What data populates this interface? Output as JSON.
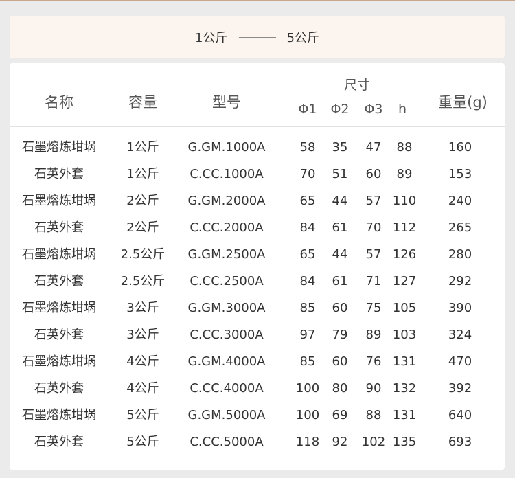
{
  "range": {
    "from": "1公斤",
    "to": "5公斤"
  },
  "headers": {
    "name": "名称",
    "capacity": "容量",
    "model": "型号",
    "size": "尺寸",
    "d1": "Φ1",
    "d2": "Φ2",
    "d3": "Φ3",
    "h": "h",
    "weight": "重量(g)"
  },
  "rows": [
    {
      "name": "石墨熔炼坩埚",
      "capacity": "1公斤",
      "model": "G.GM.1000A",
      "d1": "58",
      "d2": "35",
      "d3": "47",
      "h": "88",
      "weight": "160"
    },
    {
      "name": "石英外套",
      "capacity": "1公斤",
      "model": "C.CC.1000A",
      "d1": "70",
      "d2": "51",
      "d3": "60",
      "h": "89",
      "weight": "153"
    },
    {
      "name": "石墨熔炼坩埚",
      "capacity": "2公斤",
      "model": "G.GM.2000A",
      "d1": "65",
      "d2": "44",
      "d3": "57",
      "h": "110",
      "weight": "240"
    },
    {
      "name": "石英外套",
      "capacity": "2公斤",
      "model": "C.CC.2000A",
      "d1": "84",
      "d2": "61",
      "d3": "70",
      "h": "112",
      "weight": "265"
    },
    {
      "name": "石墨熔炼坩埚",
      "capacity": "2.5公斤",
      "model": "G.GM.2500A",
      "d1": "65",
      "d2": "44",
      "d3": "57",
      "h": "126",
      "weight": "280"
    },
    {
      "name": "石英外套",
      "capacity": "2.5公斤",
      "model": "C.CC.2500A",
      "d1": "84",
      "d2": "61",
      "d3": "71",
      "h": "127",
      "weight": "292"
    },
    {
      "name": "石墨熔炼坩埚",
      "capacity": "3公斤",
      "model": "G.GM.3000A",
      "d1": "85",
      "d2": "60",
      "d3": "75",
      "h": "105",
      "weight": "390"
    },
    {
      "name": "石英外套",
      "capacity": "3公斤",
      "model": "C.CC.3000A",
      "d1": "97",
      "d2": "79",
      "d3": "89",
      "h": "103",
      "weight": "324"
    },
    {
      "name": "石墨熔炼坩埚",
      "capacity": "4公斤",
      "model": "G.GM.4000A",
      "d1": "85",
      "d2": "60",
      "d3": "76",
      "h": "131",
      "weight": "470"
    },
    {
      "name": "石英外套",
      "capacity": "4公斤",
      "model": "C.CC.4000A",
      "d1": "100",
      "d2": "80",
      "d3": "90",
      "h": "132",
      "weight": "392"
    },
    {
      "name": "石墨熔炼坩埚",
      "capacity": "5公斤",
      "model": "G.GM.5000A",
      "d1": "100",
      "d2": "69",
      "d3": "88",
      "h": "131",
      "weight": "640"
    },
    {
      "name": "石英外套",
      "capacity": "5公斤",
      "model": "C.CC.5000A",
      "d1": "118",
      "d2": "92",
      "d3": "102",
      "h": "135",
      "weight": "693"
    }
  ]
}
